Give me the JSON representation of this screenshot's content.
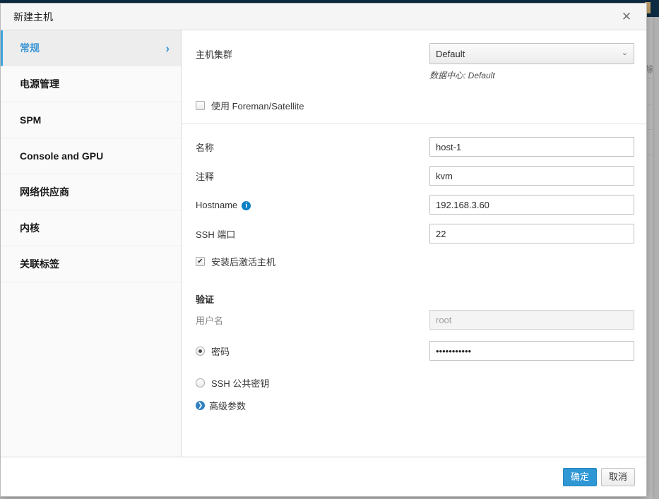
{
  "background": {
    "menu_fragment": "除"
  },
  "dialog": {
    "title": "新建主机",
    "close_icon": "close-icon",
    "close_label": "✕"
  },
  "sidebar": {
    "items": [
      {
        "label": "常规",
        "active": true,
        "chevron": "›"
      },
      {
        "label": "电源管理",
        "active": false
      },
      {
        "label": "SPM",
        "active": false
      },
      {
        "label": "Console and GPU",
        "active": false
      },
      {
        "label": "网络供应商",
        "active": false
      },
      {
        "label": "内核",
        "active": false
      },
      {
        "label": "关联标签",
        "active": false
      }
    ]
  },
  "form": {
    "cluster": {
      "label": "主机集群",
      "value": "Default",
      "options": [
        "Default"
      ],
      "caret_icon": "chevron-down-icon",
      "hint": "数据中心: Default"
    },
    "foreman": {
      "label": "使用 Foreman/Satellite",
      "checked": false
    },
    "name": {
      "label": "名称",
      "value": "host-1",
      "placeholder": ""
    },
    "comment": {
      "label": "注释",
      "value": "kvm",
      "placeholder": ""
    },
    "hostname": {
      "label": "Hostname",
      "info_icon": "info-icon",
      "info_glyph": "i",
      "value": "192.168.3.60",
      "placeholder": ""
    },
    "ssh_port": {
      "label": "SSH 端口",
      "value": "22",
      "placeholder": ""
    },
    "activate_after_install": {
      "label": "安装后激活主机",
      "checked": true
    },
    "auth": {
      "section_title": "验证",
      "username": {
        "label": "用户名",
        "value": "",
        "placeholder": "root",
        "disabled": true
      },
      "password_option": {
        "label": "密码",
        "selected": true,
        "value": "•••••••••••"
      },
      "ssh_key_option": {
        "label": "SSH 公共密钥",
        "selected": false
      },
      "advanced": {
        "label": "高级参数",
        "icon": "chevron-right-circle-icon",
        "glyph": "❯"
      }
    }
  },
  "footer": {
    "ok_label": "确定",
    "cancel_label": "取消"
  }
}
